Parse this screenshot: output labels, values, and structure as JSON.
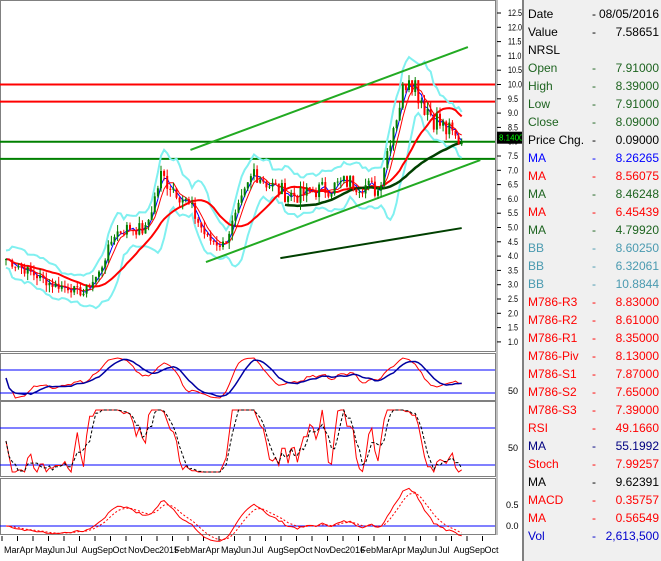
{
  "info": [
    {
      "label": "Date",
      "dash": "-",
      "value": "08/05/2016",
      "color": "#000000"
    },
    {
      "label": "Value",
      "dash": "-",
      "value": "7.58651",
      "color": "#000000"
    },
    {
      "label": "NRSL",
      "dash": "",
      "value": "",
      "color": "#000000"
    },
    {
      "label": "Open",
      "dash": "-",
      "value": "7.91000",
      "color": "#1e6420"
    },
    {
      "label": "High",
      "dash": "-",
      "value": "8.39000",
      "color": "#1e6420"
    },
    {
      "label": "Low",
      "dash": "-",
      "value": "7.91000",
      "color": "#1e6420"
    },
    {
      "label": "Close",
      "dash": "-",
      "value": "8.09000",
      "color": "#1e6420"
    },
    {
      "label": "Price Chg.",
      "dash": "-",
      "value": "0.09000",
      "color": "#000000"
    },
    {
      "label": "MA",
      "dash": "-",
      "value": "8.26265",
      "color": "#0000ff"
    },
    {
      "label": "MA",
      "dash": "-",
      "value": "8.56075",
      "color": "#ff0000"
    },
    {
      "label": "MA",
      "dash": "-",
      "value": "8.46248",
      "color": "#1e6420"
    },
    {
      "label": "MA",
      "dash": "-",
      "value": "6.45439",
      "color": "#ff0000"
    },
    {
      "label": "MA",
      "dash": "-",
      "value": "4.79920",
      "color": "#1e6420"
    },
    {
      "label": "BB",
      "dash": "-",
      "value": "8.60250",
      "color": "#4a9ab0"
    },
    {
      "label": "BB",
      "dash": "-",
      "value": "6.32061",
      "color": "#4a9ab0"
    },
    {
      "label": "BB",
      "dash": "-",
      "value": "10.8844",
      "color": "#4a9ab0"
    },
    {
      "label": "M786-R3",
      "dash": "-",
      "value": "8.83000",
      "color": "#ff0000"
    },
    {
      "label": "M786-R2",
      "dash": "-",
      "value": "8.61000",
      "color": "#ff0000"
    },
    {
      "label": "M786-R1",
      "dash": "-",
      "value": "8.35000",
      "color": "#ff0000"
    },
    {
      "label": "M786-Piv",
      "dash": "-",
      "value": "8.13000",
      "color": "#ff0000"
    },
    {
      "label": "M786-S1",
      "dash": "-",
      "value": "7.87000",
      "color": "#ff0000"
    },
    {
      "label": "M786-S2",
      "dash": "-",
      "value": "7.65000",
      "color": "#ff0000"
    },
    {
      "label": "M786-S3",
      "dash": "-",
      "value": "7.39000",
      "color": "#ff0000"
    },
    {
      "label": "RSI",
      "dash": "-",
      "value": "49.1660",
      "color": "#ff0000"
    },
    {
      "label": "MA",
      "dash": "-",
      "value": "55.1992",
      "color": "#000080"
    },
    {
      "label": "Stoch",
      "dash": "-",
      "value": "7.99257",
      "color": "#ff0000"
    },
    {
      "label": "MA",
      "dash": "-",
      "value": "9.62391",
      "color": "#000000"
    },
    {
      "label": "MACD",
      "dash": "-",
      "value": "0.35757",
      "color": "#ff0000"
    },
    {
      "label": "MA",
      "dash": "-",
      "value": "0.56549",
      "color": "#ff0000"
    },
    {
      "label": "Vol",
      "dash": "-",
      "value": "2,613,500",
      "color": "#0000cc"
    }
  ],
  "chart_data": {
    "type": "candlestick",
    "symbol": "NRSL",
    "price_ticks": [
      "12.5",
      "12.0",
      "11.5",
      "11.0",
      "10.5",
      "10.0",
      "9.5",
      "9.0",
      "8.5",
      "8.0",
      "7.5",
      "7.0",
      "6.5",
      "6.0",
      "5.5",
      "5.0",
      "4.5",
      "4.0",
      "3.5",
      "3.0",
      "2.5",
      "2.0",
      "1.5",
      "1.0"
    ],
    "ylim": [
      1.0,
      12.5
    ],
    "last_price_tag": "8.1400",
    "last_price": 8.14,
    "months": [
      "Mar",
      "Apr",
      "May",
      "Jun",
      "Jul",
      "Aug",
      "Sep",
      "Oct",
      "Nov",
      "Dec",
      "2015",
      "Feb",
      "Mar",
      "Apr",
      "May",
      "Jun",
      "Jul",
      "Aug",
      "Sep",
      "Oct",
      "Nov",
      "Dec",
      "2016",
      "Feb",
      "Mar",
      "Apr",
      "May",
      "Jun",
      "Jul",
      "Aug",
      "Sep",
      "Oct"
    ],
    "monthly_close_approx": [
      3.9,
      3.6,
      3.3,
      3.0,
      2.9,
      2.7,
      3.4,
      4.8,
      5.0,
      4.9,
      6.8,
      6.3,
      5.6,
      4.6,
      4.4,
      5.6,
      7.0,
      6.5,
      6.2,
      6.1,
      6.3,
      6.4,
      6.6,
      6.5,
      6.3,
      8.6,
      10.5,
      9.3,
      8.6,
      8.1
    ],
    "horizontal_lines": [
      {
        "value": 10.0,
        "color": "#ff0000"
      },
      {
        "value": 9.4,
        "color": "#ff0000"
      },
      {
        "value": 8.0,
        "color": "#008000"
      },
      {
        "value": 7.4,
        "color": "#008000"
      }
    ],
    "trend_lines": [
      {
        "from": [
          11.9,
          7.71
        ],
        "to": [
          29.8,
          11.31
        ],
        "color": "#22aa22"
      },
      {
        "from": [
          12.9,
          3.79
        ],
        "to": [
          30.6,
          7.36
        ],
        "color": "#22aa22"
      },
      {
        "from": [
          17.7,
          3.93
        ],
        "to": [
          29.4,
          4.98
        ],
        "color": "#004000"
      }
    ],
    "panel2_ticks": [
      "50"
    ],
    "panel3_ticks": [
      "50"
    ],
    "panel4_ticks": [
      "0.5",
      "0.0"
    ]
  }
}
